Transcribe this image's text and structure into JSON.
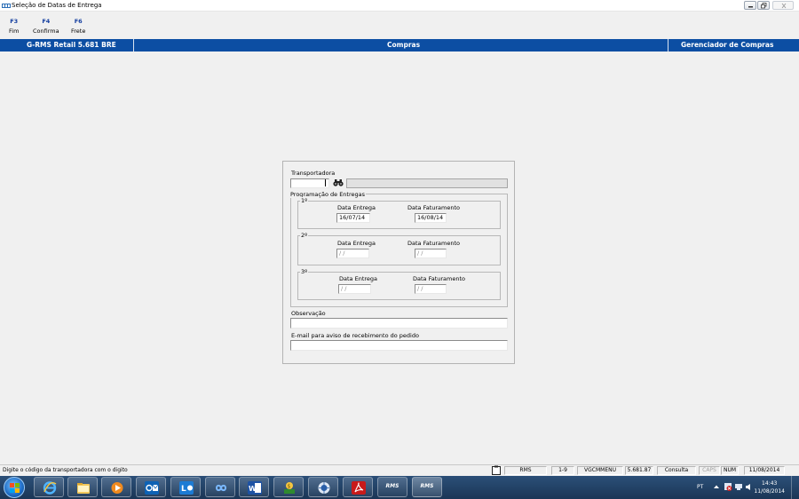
{
  "window": {
    "title": "Seleção de Datas de Entrega"
  },
  "toolbar": {
    "keys": [
      {
        "key": "F3",
        "label": "Fim"
      },
      {
        "key": "F4",
        "label": "Confirma"
      },
      {
        "key": "F6",
        "label": "Frete"
      }
    ]
  },
  "header": {
    "version": "G-RMS Retail 5.681 BRE",
    "module": "Compras",
    "manager": "Gerenciador de Compras"
  },
  "form": {
    "transportadora_label": "Transportadora",
    "transportadora_value": "",
    "transportadora_name": "",
    "programacao_title": "Programação de Entregas",
    "entregas": [
      {
        "ordinal": "1º",
        "data_entrega_label": "Data Entrega",
        "data_entrega": "16/07/14",
        "data_faturamento_label": "Data Faturamento",
        "data_faturamento": "16/08/14"
      },
      {
        "ordinal": "2º",
        "data_entrega_label": "Data Entrega",
        "data_entrega": " / /",
        "data_faturamento_label": "Data Faturamento",
        "data_faturamento": " / /"
      },
      {
        "ordinal": "3º",
        "data_entrega_label": "Data Entrega",
        "data_entrega": " / /",
        "data_faturamento_label": "Data Faturamento",
        "data_faturamento": " / /"
      }
    ],
    "observacao_label": "Observação",
    "observacao_value": "",
    "email_label": "E-mail para aviso de recebimento do pedido",
    "email_value": ""
  },
  "statusbar": {
    "message": "Digite o código da transportadora com o digito",
    "cells": [
      "RMS",
      "1-9",
      "VGCMMENU",
      "5.681.87",
      "Consulta",
      "CAPS",
      "NUM",
      "11/08/2014"
    ]
  },
  "taskbar": {
    "apps": [
      "ie-icon",
      "explorer-icon",
      "media-player-icon",
      "outlook-icon",
      "lync-icon",
      "infinity-icon",
      "word-icon",
      "money-icon",
      "network-icon",
      "acrobat-icon",
      "rms-icon",
      "rms-icon"
    ],
    "rms_label": "RMS",
    "language": "PT",
    "time": "14:43",
    "date": "11/08/2014"
  },
  "colors": {
    "header_blue": "#0c4ea3",
    "fkey_blue": "#1640a0",
    "taskbar": "#1f3a5c"
  }
}
